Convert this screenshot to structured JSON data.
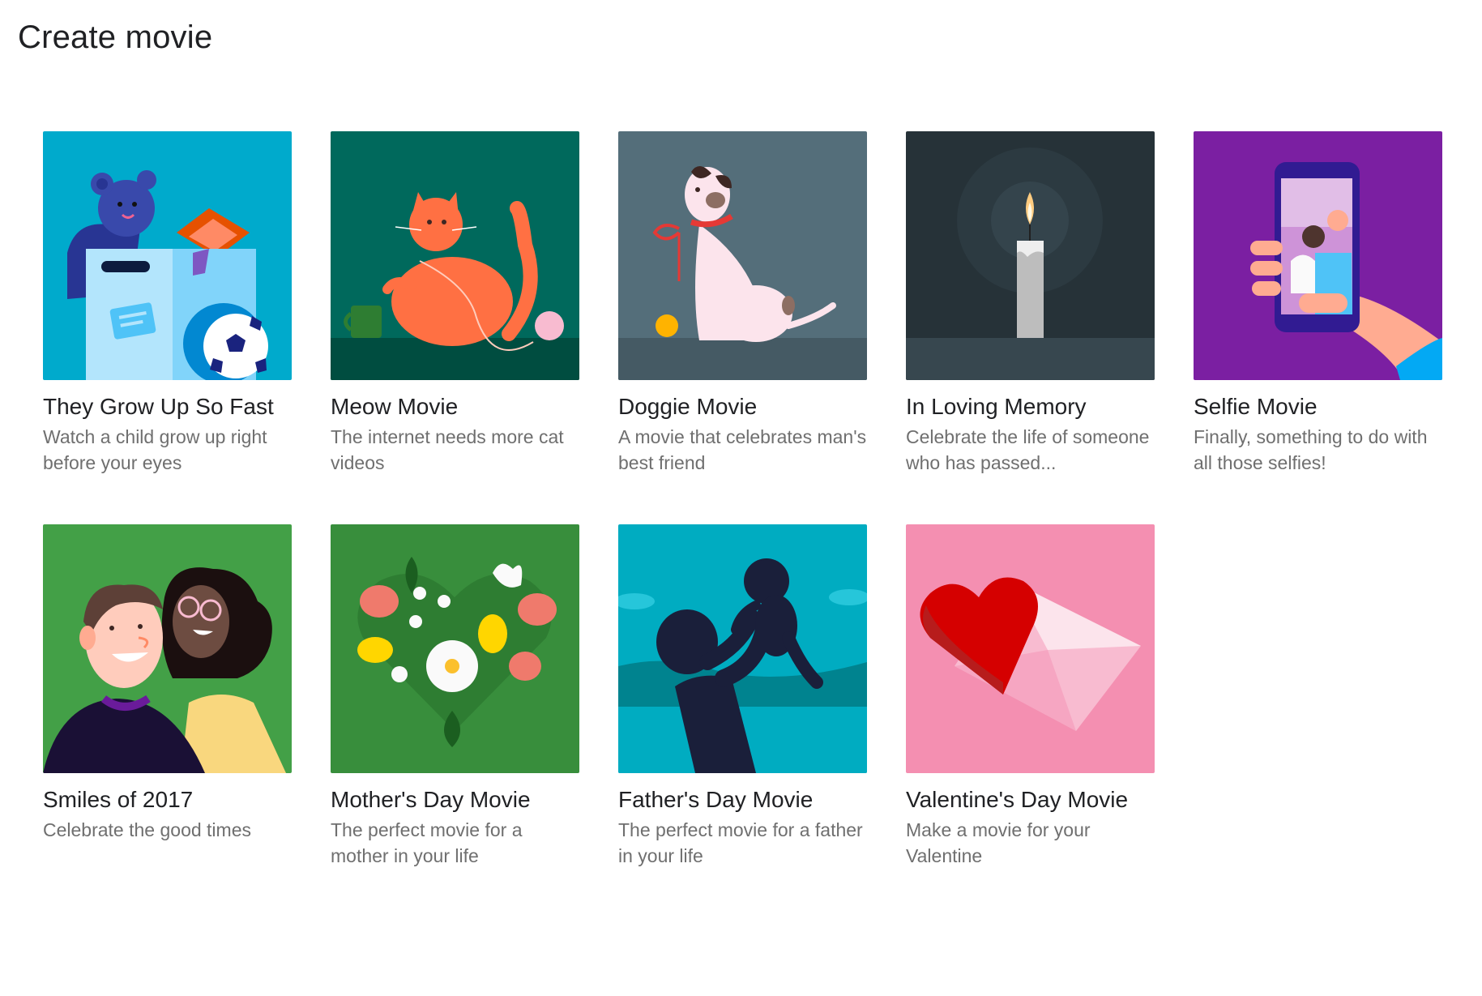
{
  "page": {
    "title": "Create movie"
  },
  "cards": [
    {
      "title": "They Grow Up So Fast",
      "description": "Watch a child grow up right before your eyes",
      "icon": "teddy-bear-toybox-illustration",
      "background": "#00aacc"
    },
    {
      "title": "Meow Movie",
      "description": "The internet needs more cat videos",
      "icon": "cat-illustration",
      "background": "#00695c"
    },
    {
      "title": "Doggie Movie",
      "description": "A movie that celebrates man's best friend",
      "icon": "dog-illustration",
      "background": "#546e7a"
    },
    {
      "title": "In Loving Memory",
      "description": "Celebrate the life of someone who has passed...",
      "icon": "candle-illustration",
      "background": "#263238"
    },
    {
      "title": "Selfie Movie",
      "description": "Finally, something to do with all those selfies!",
      "icon": "selfie-phone-illustration",
      "background": "#7b1fa2"
    },
    {
      "title": "Smiles of 2017",
      "description": "Celebrate the good times",
      "icon": "smiling-couple-illustration",
      "background": "#43a047"
    },
    {
      "title": "Mother's Day Movie",
      "description": "The perfect movie for a mother in your life",
      "icon": "flower-heart-illustration",
      "background": "#388e3c"
    },
    {
      "title": "Father's Day Movie",
      "description": "The perfect movie for a father in your life",
      "icon": "father-lifting-baby-illustration",
      "background": "#00acc1"
    },
    {
      "title": "Valentine's Day Movie",
      "description": "Make a movie for your Valentine",
      "icon": "heart-envelope-illustration",
      "background": "#f48fb1"
    }
  ]
}
